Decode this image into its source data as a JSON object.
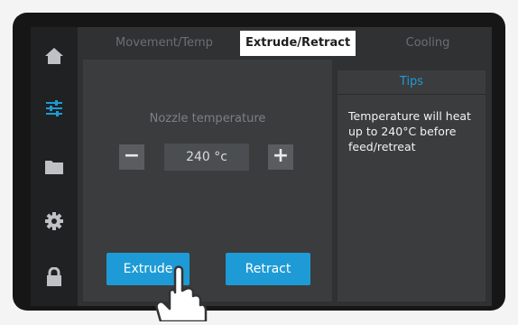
{
  "sidebar": {
    "items": [
      {
        "icon": "home-icon"
      },
      {
        "icon": "sliders-icon",
        "active": true
      },
      {
        "icon": "folder-icon"
      },
      {
        "icon": "gear-icon"
      },
      {
        "icon": "lock-icon"
      }
    ]
  },
  "tabs": [
    {
      "label": "Movement/Temp"
    },
    {
      "label": "Extrude/Retract",
      "active": true
    },
    {
      "label": "Cooling"
    }
  ],
  "main": {
    "nozzle_label": "Nozzle temperature",
    "decrement_label": "−",
    "increment_label": "+",
    "temperature_value": "240 °c",
    "extrude_label": "Extrude",
    "retract_label": "Retract"
  },
  "tips": {
    "title": "Tips",
    "text": "Temperature will heat up to 240°C before feed/retreat"
  },
  "colors": {
    "accent": "#1e9bd6",
    "background": "#2f3133",
    "sidebar": "#202122",
    "panel": "#3a3c3e"
  }
}
